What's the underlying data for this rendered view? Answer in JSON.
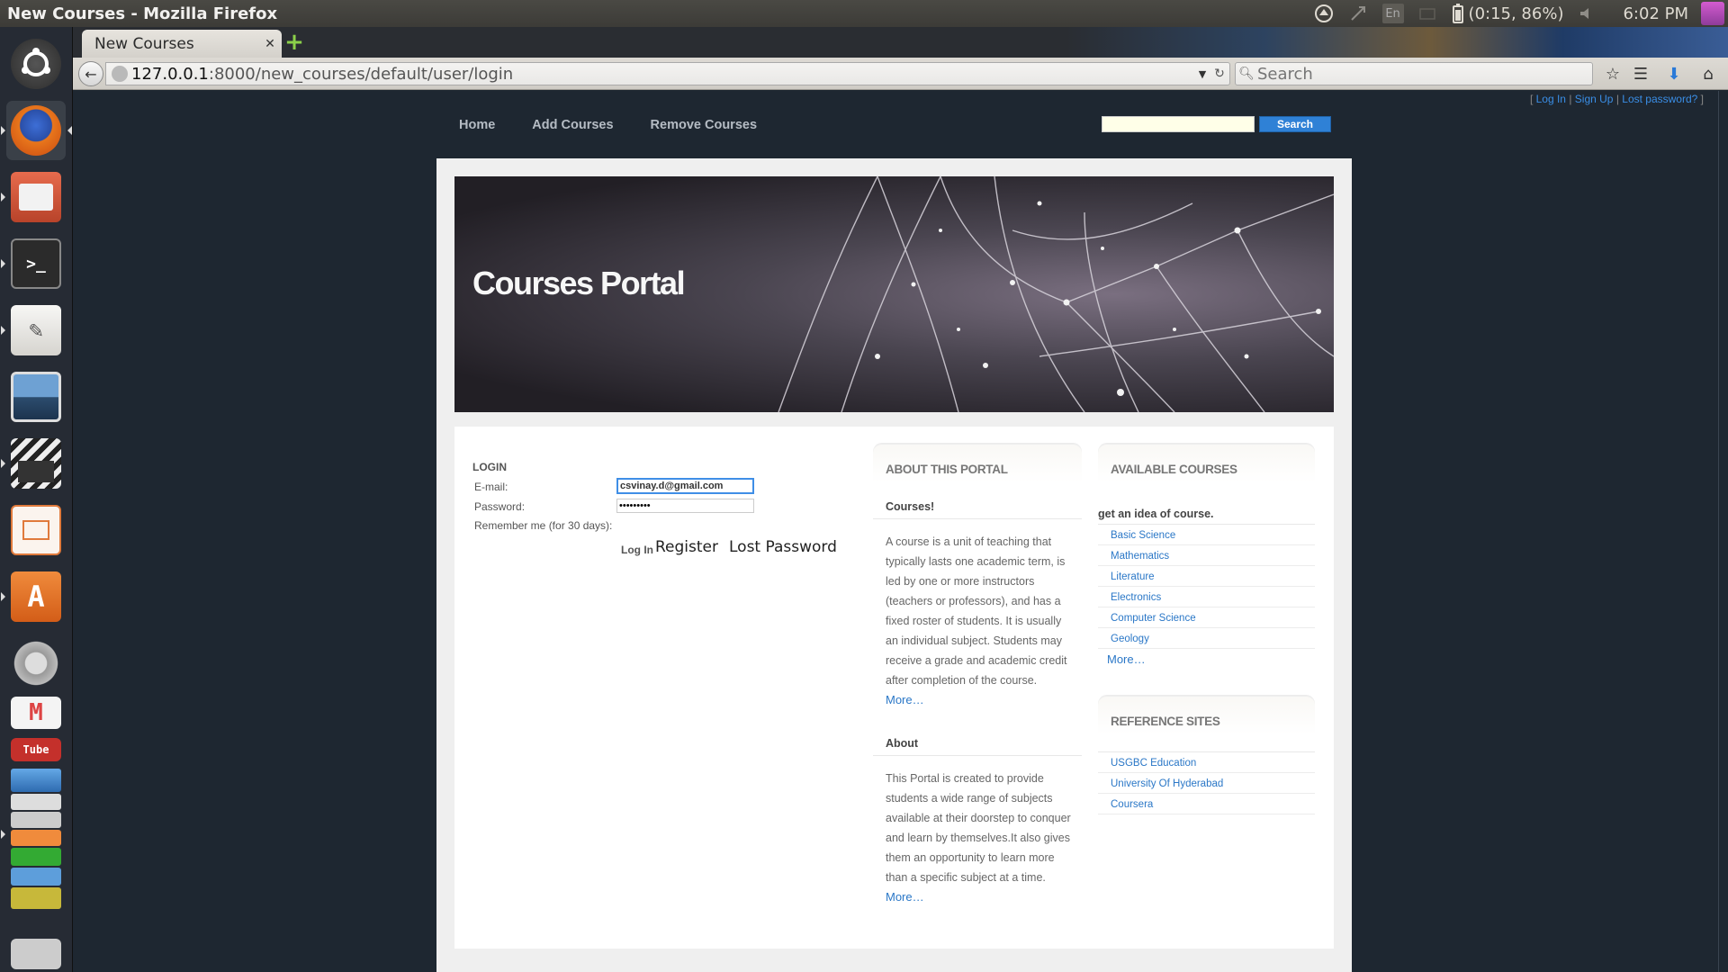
{
  "window": {
    "title": "New Courses - Mozilla Firefox"
  },
  "panel": {
    "lang": "En",
    "battery": "(0:15, 86%)",
    "clock": "6:02 PM",
    "icons": [
      "network-icon",
      "bluetooth-icon",
      "keyboard-layout-icon",
      "battery-icon",
      "volume-icon",
      "session-icon"
    ]
  },
  "launcher": {
    "items": [
      "ubuntu-dash",
      "firefox",
      "files",
      "terminal",
      "text-editor",
      "image-viewer",
      "video-editor",
      "presentation",
      "software-center",
      "system-settings",
      "gmail",
      "youtube",
      "stacked-apps-1",
      "stacked-apps-2"
    ]
  },
  "browser": {
    "tab_title": "New Courses",
    "url_host": "127.0.0.1",
    "url_rest": ":8000/new_courses/default/user/login",
    "search_placeholder": "Search"
  },
  "site": {
    "auth": {
      "open": "[ ",
      "login": "Log In",
      "sep1": " | ",
      "signup": "Sign Up",
      "sep2": " | ",
      "lost": "Lost password?",
      "close": " ]"
    },
    "nav": {
      "home": "Home",
      "add": "Add Courses",
      "remove": "Remove Courses"
    },
    "search_button": "Search",
    "banner_title": "Courses Portal",
    "login": {
      "heading": "LOGIN",
      "email_label": "E-mail:",
      "email_value": "csvinay.d@gmail.com",
      "password_label": "Password:",
      "password_value": "•••••••••",
      "remember_label": "Remember me (for 30 days):",
      "login_button": "Log In",
      "register": "Register",
      "lost_password": "Lost Password"
    },
    "about": {
      "heading": "ABOUT THIS PORTAL",
      "courses_heading": "Courses!",
      "courses_text": "A course is a unit of teaching that typically lasts one academic term, is led by one or more instructors (teachers or professors), and has a fixed roster of students. It is usually an individual subject. Students may receive a grade and academic credit after completion of the course.",
      "more": "More…",
      "about_heading": "About",
      "about_text": "This Portal is created to provide students a wide range of subjects available at their doorstep to conquer and learn by themselves.It also gives them an opportunity to learn more than a specific subject at a time.",
      "about_more": "More…"
    },
    "courses": {
      "heading": "AVAILABLE COURSES",
      "sub": "get an idea of course.",
      "items": [
        "Basic Science",
        "Mathematics",
        "Literature",
        "Electronics",
        "Computer Science",
        "Geology"
      ],
      "more": "More…"
    },
    "references": {
      "heading": "REFERENCE SITES",
      "items": [
        "USGBC Education",
        "University Of Hyderabad",
        "Coursera"
      ]
    }
  }
}
